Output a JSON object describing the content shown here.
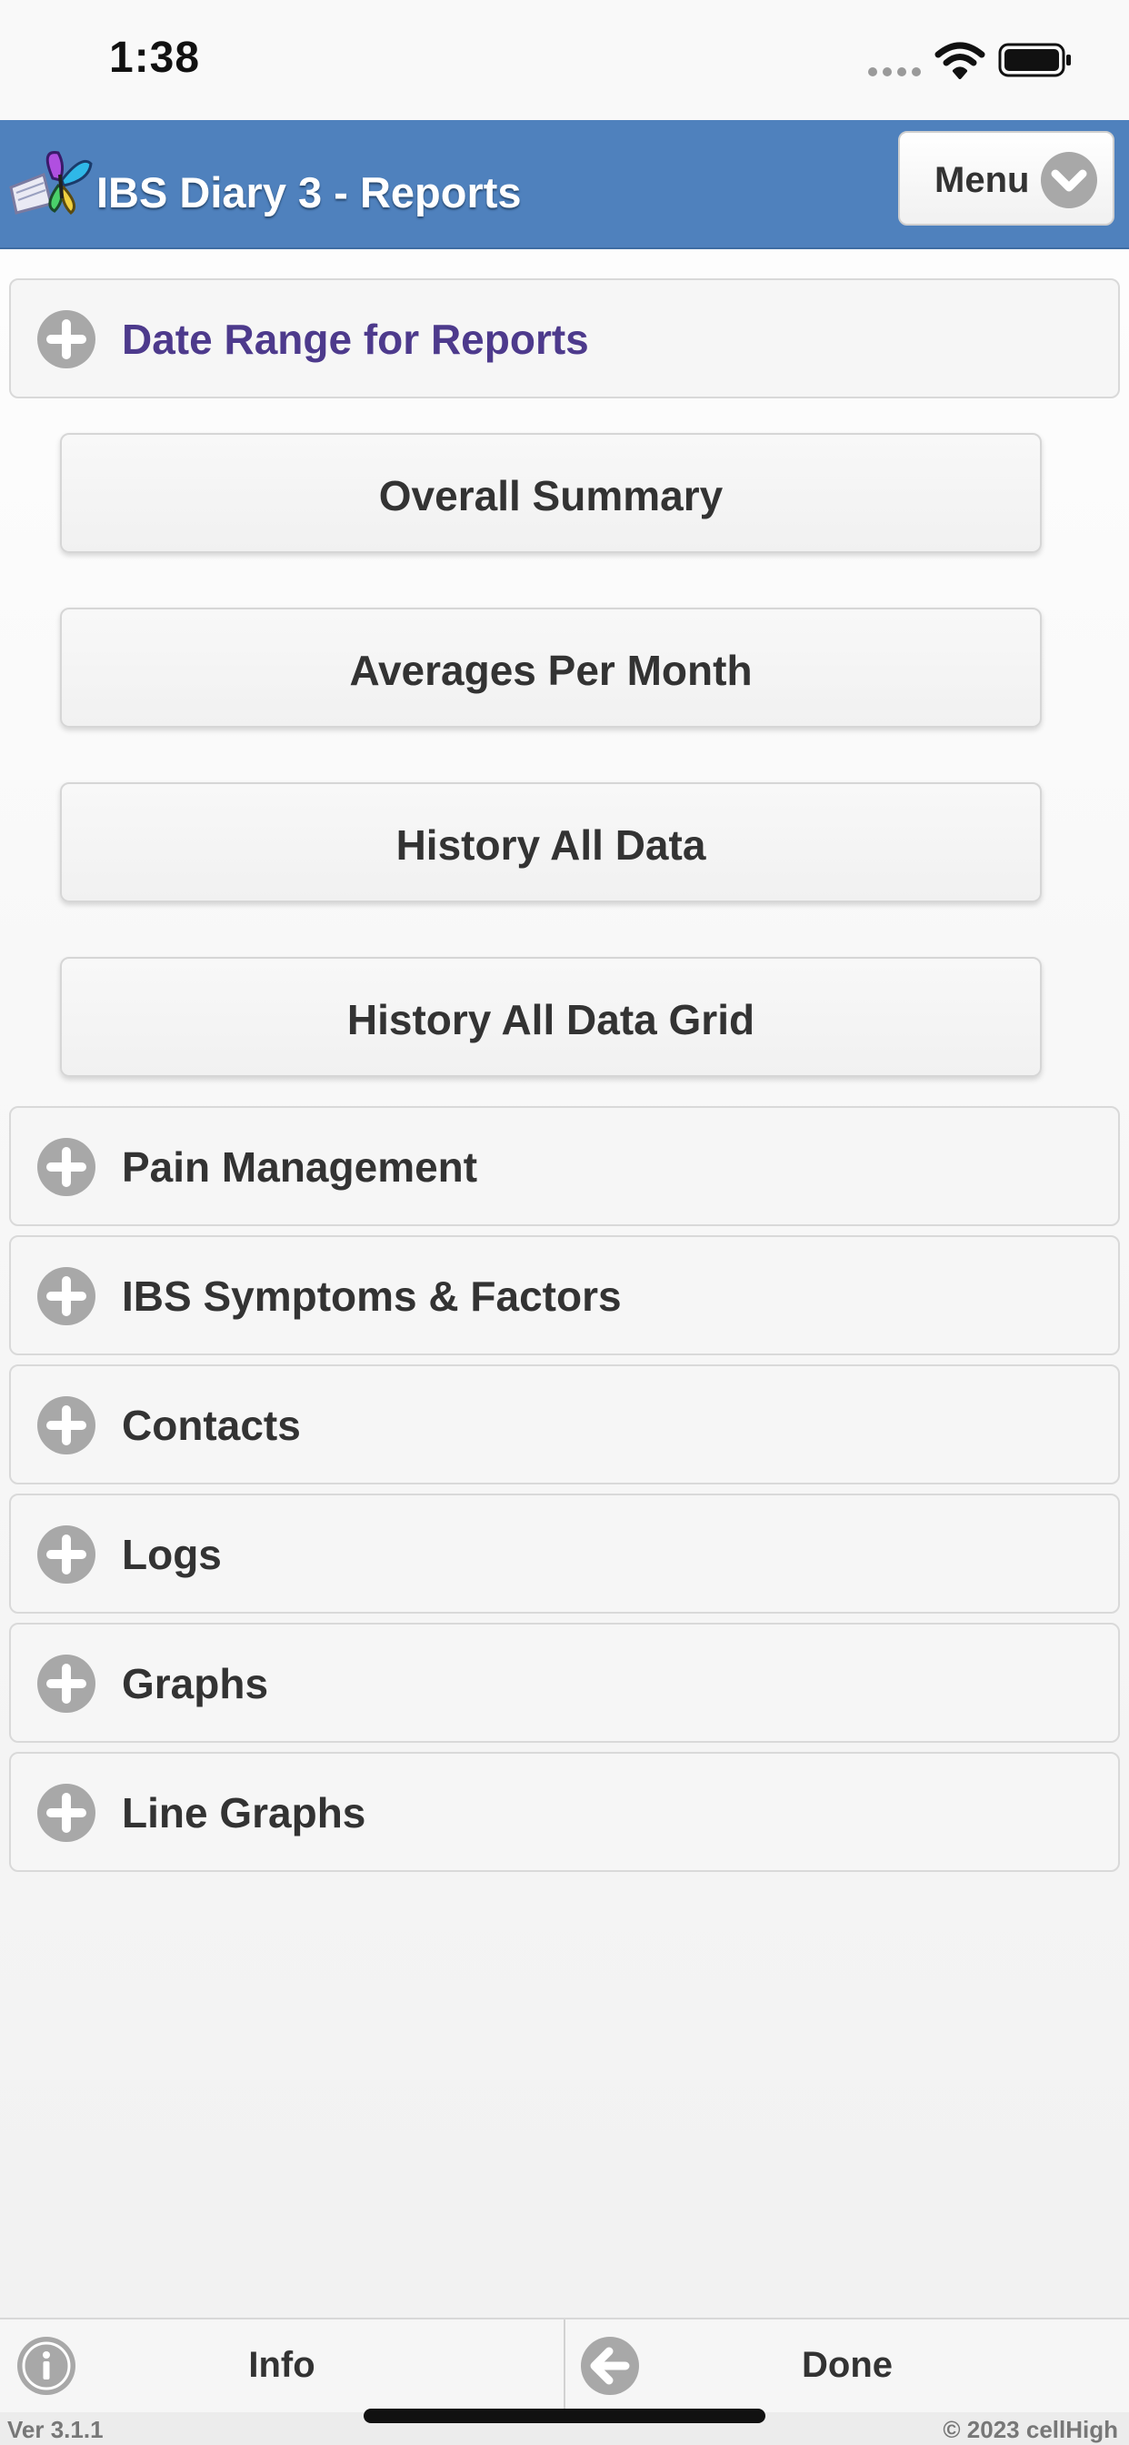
{
  "status_bar": {
    "time": "1:38",
    "icons": [
      "signal-icon",
      "wifi-icon",
      "battery-icon"
    ]
  },
  "header": {
    "title": "IBS Diary 3 - Reports",
    "menu_label": "Menu",
    "logo": "butterfly-book-logo",
    "background_color": "#4f81bd"
  },
  "date_range": {
    "label": "Date Range for Reports",
    "color": "#4d3a8c"
  },
  "report_buttons": [
    {
      "label": "Overall Summary"
    },
    {
      "label": "Averages Per Month"
    },
    {
      "label": "History All Data"
    },
    {
      "label": "History All Data Grid"
    }
  ],
  "sections": [
    {
      "label": "Pain Management"
    },
    {
      "label": "IBS Symptoms & Factors"
    },
    {
      "label": "Contacts"
    },
    {
      "label": "Logs"
    },
    {
      "label": "Graphs"
    },
    {
      "label": "Line Graphs"
    }
  ],
  "footer": {
    "info_label": "Info",
    "done_label": "Done",
    "version": "Ver 3.1.1",
    "copyright": "© 2023 cellHigh"
  }
}
